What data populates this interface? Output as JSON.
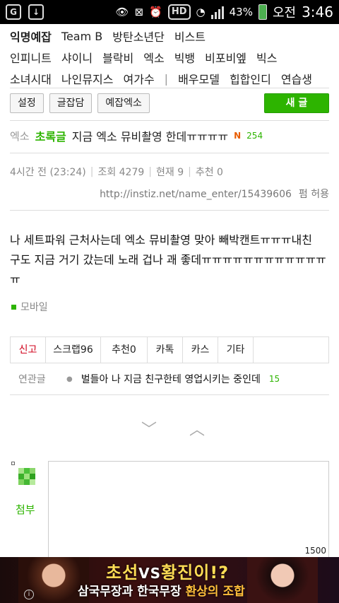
{
  "status_bar": {
    "battery_percent": "43%",
    "ampm": "오전",
    "time": "3:46",
    "hd_label": "HD"
  },
  "category_nav": {
    "row1": [
      "익명예잡",
      "Team B",
      "방탄소년단",
      "비스트"
    ],
    "row2": [
      "인피니트",
      "샤이니",
      "블락비",
      "엑소",
      "빅뱅",
      "비포비엪",
      "빅스"
    ],
    "row3": [
      "소녀시대",
      "나인뮤지스",
      "여가수",
      "|",
      "배우모델",
      "힙합인디",
      "연습생"
    ]
  },
  "buttons": {
    "settings": "설정",
    "gossip": "글잡담",
    "exo_gossip": "예잡엑소",
    "new_post": "새 글"
  },
  "post": {
    "board": "엑소",
    "rookie_label": "초록글",
    "title": "지금 엑소 뮤비촬영 한데ㅠㅠㅠㅠ",
    "new_badge": "N",
    "comment_count": "254",
    "time_ago": "4시간 전 (23:24)",
    "views": "조회 4279",
    "current": "현재 9",
    "recommend": "추천 0",
    "url": "http://instiz.net/name_enter/15439606",
    "permission": "펌 허용",
    "body_line1": "나 세트파워 근처사는데 엑소 뮤비촬영 맞아 빼박캔트ㅠㅠㅠ내친",
    "body_line2": "구도 지금 거기 갔는데 노래 겁나 괘 좋데ㅠㅠㅠㅠㅠㅠㅠㅠㅠㅠㅠㅠㅠ",
    "device": "모바일"
  },
  "tabs": {
    "report": "신고",
    "scrap": "스크랩96",
    "recommend": "추천0",
    "kakao_talk": "카톡",
    "kakao_story": "카스",
    "etc": "기타"
  },
  "related": {
    "label": "연관글",
    "title": "벌들아 나 지금 친구한테 영업시키는 중인데",
    "count": "15"
  },
  "comment": {
    "attach": "첨부",
    "char_limit": "1500"
  },
  "ad": {
    "title_left": "초선",
    "title_vs": "VS",
    "title_right": "황진이!?",
    "sub_a": "삼국무장과 한국무장",
    "sub_b": "환상의 조합",
    "info": "i"
  },
  "colors": {
    "accent_green": "#2db400",
    "report_red": "#d0021b"
  }
}
